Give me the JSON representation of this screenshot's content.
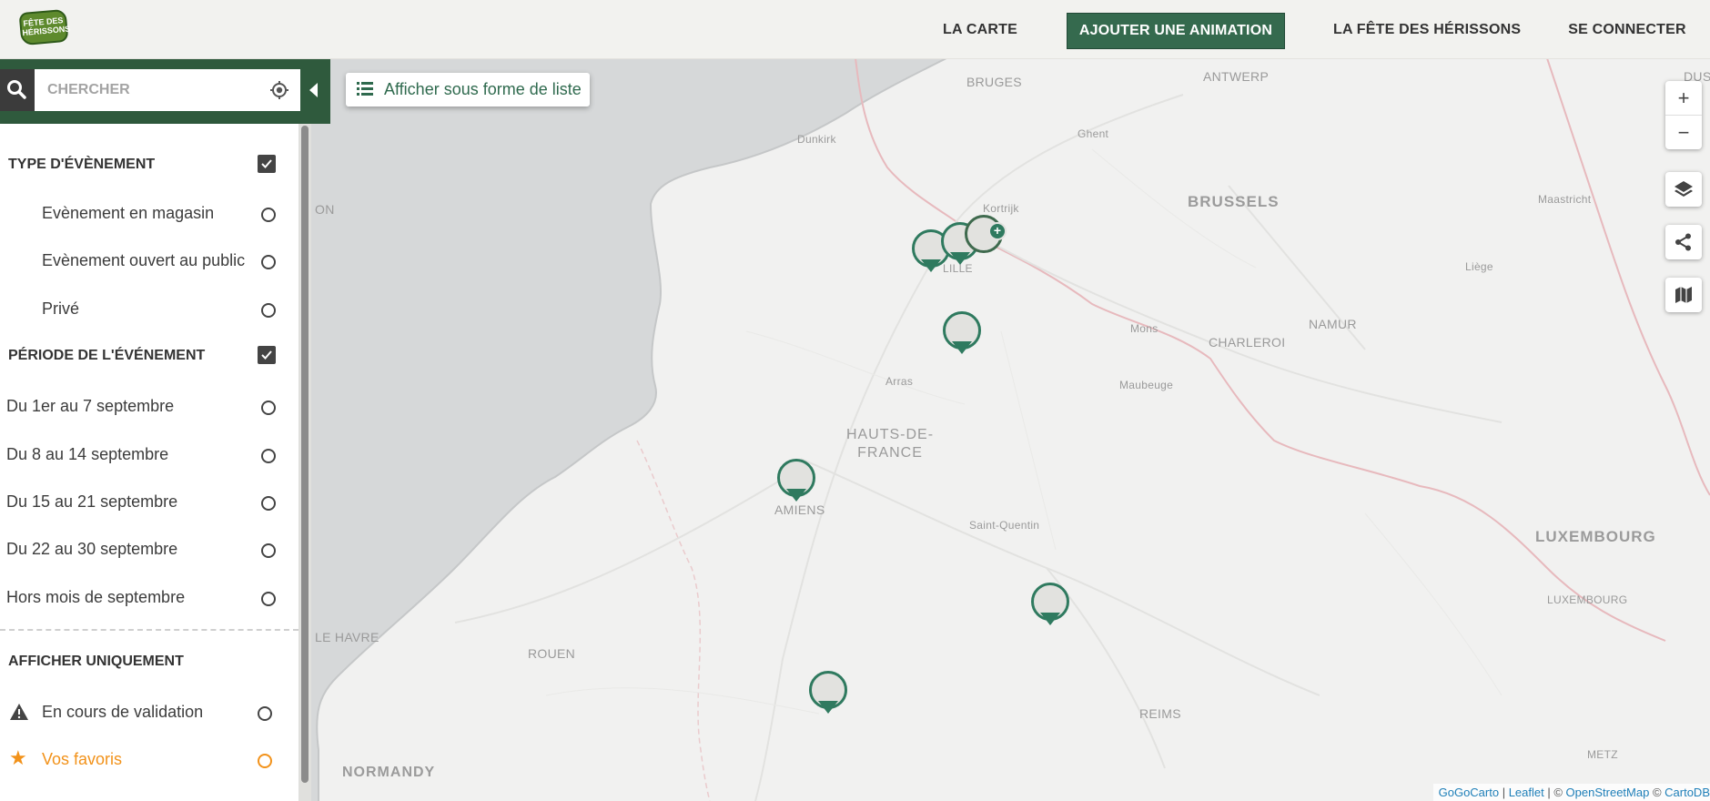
{
  "header": {
    "logo_text": "FÊTE DES HÉRISSONS",
    "nav": [
      {
        "label": "LA CARTE"
      },
      {
        "label": "AJOUTER UNE ANIMATION"
      },
      {
        "label": "LA FÊTE DES HÉRISSONS"
      },
      {
        "label": "SE CONNECTER"
      }
    ]
  },
  "search": {
    "placeholder": "CHERCHER",
    "value": ""
  },
  "list_toggle": {
    "label": "Afficher sous forme de liste"
  },
  "sidebar": {
    "sections": [
      {
        "title": "TYPE D'ÉVÈNEMENT",
        "checked": true,
        "options": [
          "Evènement en magasin",
          "Evènement ouvert au public",
          "Privé"
        ]
      },
      {
        "title": "PÉRIODE DE L'ÉVÉNEMENT",
        "checked": true,
        "options": [
          "Du 1er au 7 septembre",
          "Du 8 au 14 septembre",
          "Du 15 au 21 septembre",
          "Du 22 au 30 septembre",
          "Hors mois de septembre"
        ]
      },
      {
        "title": "AFFICHER UNIQUEMENT",
        "options": [
          "En cours de validation",
          "Vos favoris"
        ]
      }
    ]
  },
  "map": {
    "labels": {
      "bruges": "BRUGES",
      "antwerp": "ANTWERP",
      "dus": "DUS",
      "dunkirk": "Dunkirk",
      "ghent": "Ghent",
      "kortrijk": "Kortrijk",
      "brussels": "BRUSSELS",
      "maastricht": "Maastricht",
      "lille": "LILLE",
      "liege": "Liège",
      "mons": "Mons",
      "namur": "NAMUR",
      "charleroi": "CHARLEROI",
      "arras": "Arras",
      "maubeuge": "Maubeuge",
      "hdf1": "HAUTS-DE-",
      "hdf2": "FRANCE",
      "amiens": "AMIENS",
      "saint_quentin": "Saint-Quentin",
      "luxembourg": "LUXEMBOURG",
      "luxembourg_city": "LUXEMBOURG",
      "le_havre": "LE HAVRE",
      "on": "ON",
      "rouen": "ROUEN",
      "reims": "REIMS",
      "normandy": "NORMANDY",
      "metz": "METZ"
    },
    "attribution": {
      "gogocarto": "GoGoCarto",
      "sep1": " | ",
      "leaflet": "Leaflet",
      "sep2": " | © ",
      "osm": "OpenStreetMap",
      "sep3": " © ",
      "carto": "CartoDB"
    },
    "controls": {
      "zoom_in": "+",
      "zoom_out": "−"
    }
  },
  "colors": {
    "brand_green": "#356a4e",
    "marker_green": "#2f7a5f",
    "favorite_orange": "#f2921a",
    "sidebar_header": "#2f5a3d"
  }
}
